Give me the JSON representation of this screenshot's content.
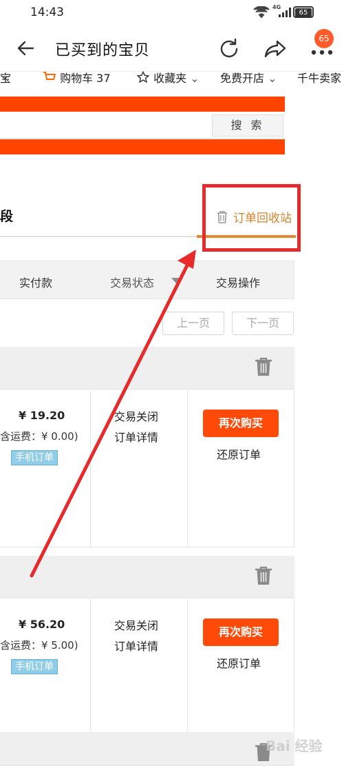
{
  "status_bar": {
    "time": "14:43",
    "network": "4G",
    "battery": "65"
  },
  "title_bar": {
    "title": "已买到的宝贝",
    "notification_count": "65"
  },
  "top_nav": {
    "items": [
      "宝",
      "购物车 37",
      "收藏夹",
      "免费开店",
      "千牛卖家"
    ]
  },
  "search": {
    "button_label": "搜 索",
    "placeholder": ""
  },
  "tabs": {
    "partial_label": "段",
    "recycle_label": "订单回收站"
  },
  "table_header": {
    "paid": "实付款",
    "status": "交易状态",
    "actions": "交易操作"
  },
  "pager": {
    "prev": "上一页",
    "next": "下一页"
  },
  "orders": [
    {
      "price": "¥ 19.20",
      "shipping": "含运费：¥ 0.00)",
      "tag": "手机订单",
      "status": "交易关闭",
      "detail": "订单详情",
      "rebuy": "再次购买",
      "restore": "还原订单"
    },
    {
      "price": "¥ 56.20",
      "shipping": "含运费：¥ 5.00)",
      "tag": "手机订单",
      "status": "交易关闭",
      "detail": "订单详情",
      "rebuy": "再次购买",
      "restore": "还原订单"
    }
  ],
  "watermark": "Bai 经验",
  "colors": {
    "accent": "#ff4400",
    "recycle": "#d9822b",
    "annotation": "#e52b2b",
    "rebuy": "#ff4a0a"
  }
}
